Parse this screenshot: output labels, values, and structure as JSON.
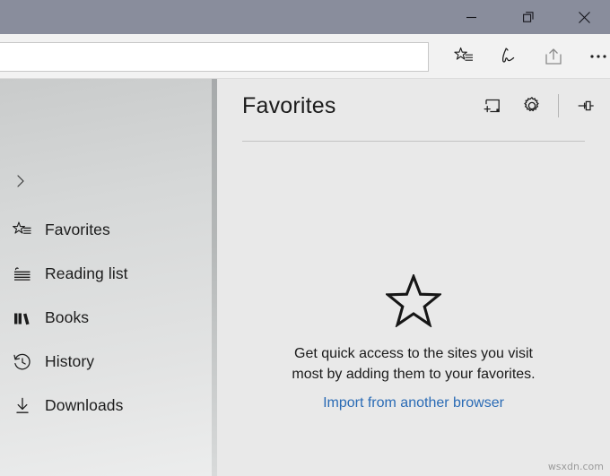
{
  "window": {
    "titlebar_color": "#898d9c",
    "controls": [
      {
        "name": "minimize",
        "label": "Minimize"
      },
      {
        "name": "restore",
        "label": "Restore Down"
      },
      {
        "name": "close",
        "label": "Close"
      }
    ]
  },
  "toolbar": {
    "address": {
      "value": "",
      "placeholder": ""
    },
    "icons": [
      {
        "name": "favorites-hub-icon",
        "label": "Favorites, reading list, books, history and downloads"
      },
      {
        "name": "web-note-icon",
        "label": "Make a Web Note"
      },
      {
        "name": "share-icon",
        "label": "Share"
      },
      {
        "name": "more-icon",
        "label": "Settings and more"
      }
    ]
  },
  "sidebar": {
    "expand_label": "Expand",
    "items": [
      {
        "label": "Favorites",
        "icon": "favorites-star-list-icon"
      },
      {
        "label": "Reading list",
        "icon": "reading-list-icon"
      },
      {
        "label": "Books",
        "icon": "books-icon"
      },
      {
        "label": "History",
        "icon": "history-clock-icon"
      },
      {
        "label": "Downloads",
        "icon": "downloads-arrow-icon"
      }
    ]
  },
  "panel": {
    "title": "Favorites",
    "actions": [
      {
        "name": "add-folder-button",
        "label": "Add new folder"
      },
      {
        "name": "settings-button",
        "label": "Manage favorites"
      },
      {
        "name": "pin-button",
        "label": "Pin this pane"
      }
    ],
    "empty_state": {
      "icon": "star-outline-icon",
      "message": "Get quick access to the sites you visit most by adding them to your favorites.",
      "link_label": "Import from another browser",
      "link_color": "#2a6bb5"
    }
  },
  "watermark": {
    "text": "wsxdn.com"
  }
}
